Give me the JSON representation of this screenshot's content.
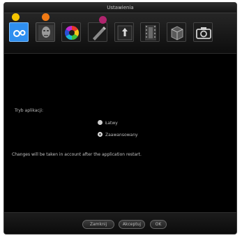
{
  "window": {
    "title": "Ustawienia"
  },
  "toolbar": {
    "items": [
      {
        "name": "general",
        "icon": "gears-icon"
      },
      {
        "name": "face",
        "icon": "face-icon"
      },
      {
        "name": "colors",
        "icon": "color-wheel-icon"
      },
      {
        "name": "brush",
        "icon": "brush-icon"
      },
      {
        "name": "export",
        "icon": "upload-arrow-icon"
      },
      {
        "name": "film",
        "icon": "film-strip-icon"
      },
      {
        "name": "plugins",
        "icon": "puzzle-box-icon"
      },
      {
        "name": "camera",
        "icon": "camera-icon"
      }
    ],
    "selected_index": 0,
    "markers": [
      "#f5c400",
      "#f07a14",
      "#b0246e"
    ]
  },
  "settings": {
    "mode_label": "Tryb aplikacji:",
    "options": [
      {
        "label": "Łatwy",
        "selected": false
      },
      {
        "label": "Zaawansowany",
        "selected": true
      }
    ],
    "notice": "Changes will be taken in account after the application restart."
  },
  "footer": {
    "cancel_label": "Zamknij",
    "apply_label": "Akceptuj",
    "ok_label": "OK"
  },
  "colors": {
    "accent": "#2f8ff0",
    "background": "#000000",
    "text": "#bdbdbd"
  }
}
